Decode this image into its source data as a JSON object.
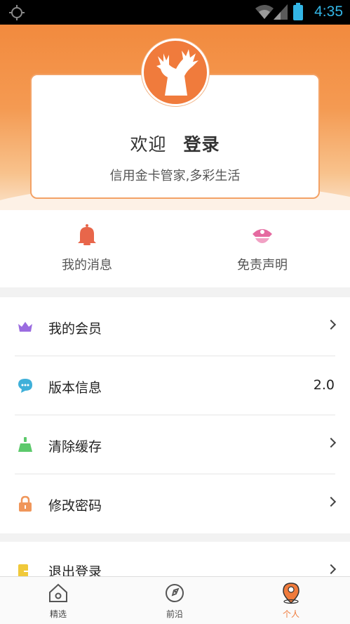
{
  "status_bar": {
    "time": "4:35"
  },
  "header": {
    "welcome": "欢迎",
    "login": "登录",
    "subtitle": "信用金卡管家,多彩生活"
  },
  "quick_actions": [
    {
      "label": "我的消息",
      "icon": "bell-icon",
      "color": "#e8664a"
    },
    {
      "label": "免责声明",
      "icon": "police-cap-icon",
      "color": "#e56aa0"
    }
  ],
  "menu": [
    {
      "label": "我的会员",
      "icon": "crown-icon",
      "color": "#9b6ce0"
    },
    {
      "label": "版本信息",
      "icon": "chat-bubbles-icon",
      "color": "#3fb0d9",
      "value": "2.0"
    },
    {
      "label": "清除缓存",
      "icon": "broom-icon",
      "color": "#5cc96b"
    },
    {
      "label": "修改密码",
      "icon": "lock-icon",
      "color": "#f0965a"
    }
  ],
  "menu2": {
    "label": "退出登录",
    "icon": "exit-icon",
    "color": "#f0c93a"
  },
  "bottom_nav": [
    {
      "label": "精选",
      "icon": "home-icon"
    },
    {
      "label": "前沿",
      "icon": "compass-icon"
    },
    {
      "label": "个人",
      "icon": "location-person-icon",
      "active": true
    }
  ],
  "colors": {
    "accent": "#f07b3c",
    "header_top": "#f28a3e",
    "status_blue": "#33b5e5"
  }
}
